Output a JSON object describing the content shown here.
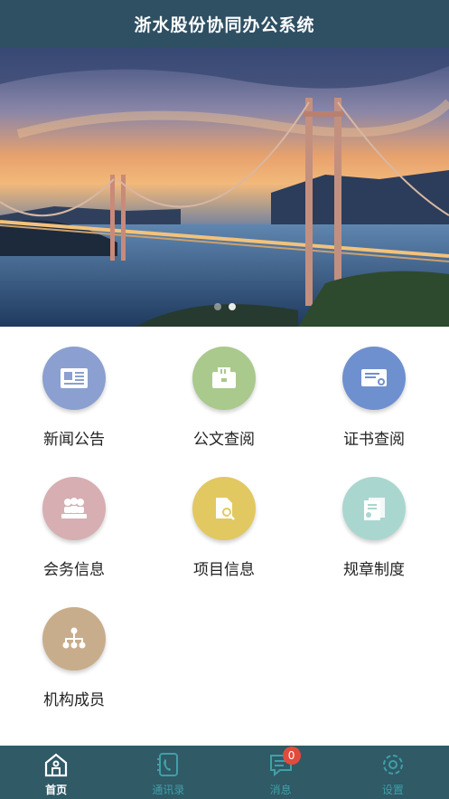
{
  "header": {
    "title": "浙水股份协同办公系统"
  },
  "banner": {
    "slides": 2,
    "active_slide": 2
  },
  "menu": [
    {
      "label": "新闻公告",
      "icon": "newspaper-icon",
      "color": "#8b9fd0"
    },
    {
      "label": "公文查阅",
      "icon": "document-folder-icon",
      "color": "#a9c98d"
    },
    {
      "label": "证书查阅",
      "icon": "certificate-icon",
      "color": "#6f90cf"
    },
    {
      "label": "会务信息",
      "icon": "meeting-people-icon",
      "color": "#d7aeb2"
    },
    {
      "label": "项目信息",
      "icon": "file-search-icon",
      "color": "#e2c860"
    },
    {
      "label": "规章制度",
      "icon": "regulation-doc-icon",
      "color": "#a9d7cf"
    },
    {
      "label": "机构成员",
      "icon": "org-chart-icon",
      "color": "#c8ad8c"
    }
  ],
  "tabbar": {
    "tabs": [
      {
        "label": "首页",
        "icon": "home-icon",
        "active": true
      },
      {
        "label": "通讯录",
        "icon": "contacts-icon",
        "active": false
      },
      {
        "label": "消息",
        "icon": "message-icon",
        "active": false,
        "badge": "0"
      },
      {
        "label": "设置",
        "icon": "settings-icon",
        "active": false
      }
    ]
  },
  "colors": {
    "header_bg": "#2f4f63",
    "tabbar_bg": "#2f5a66",
    "tab_inactive": "#3fa0a8",
    "badge": "#e24b3b"
  }
}
